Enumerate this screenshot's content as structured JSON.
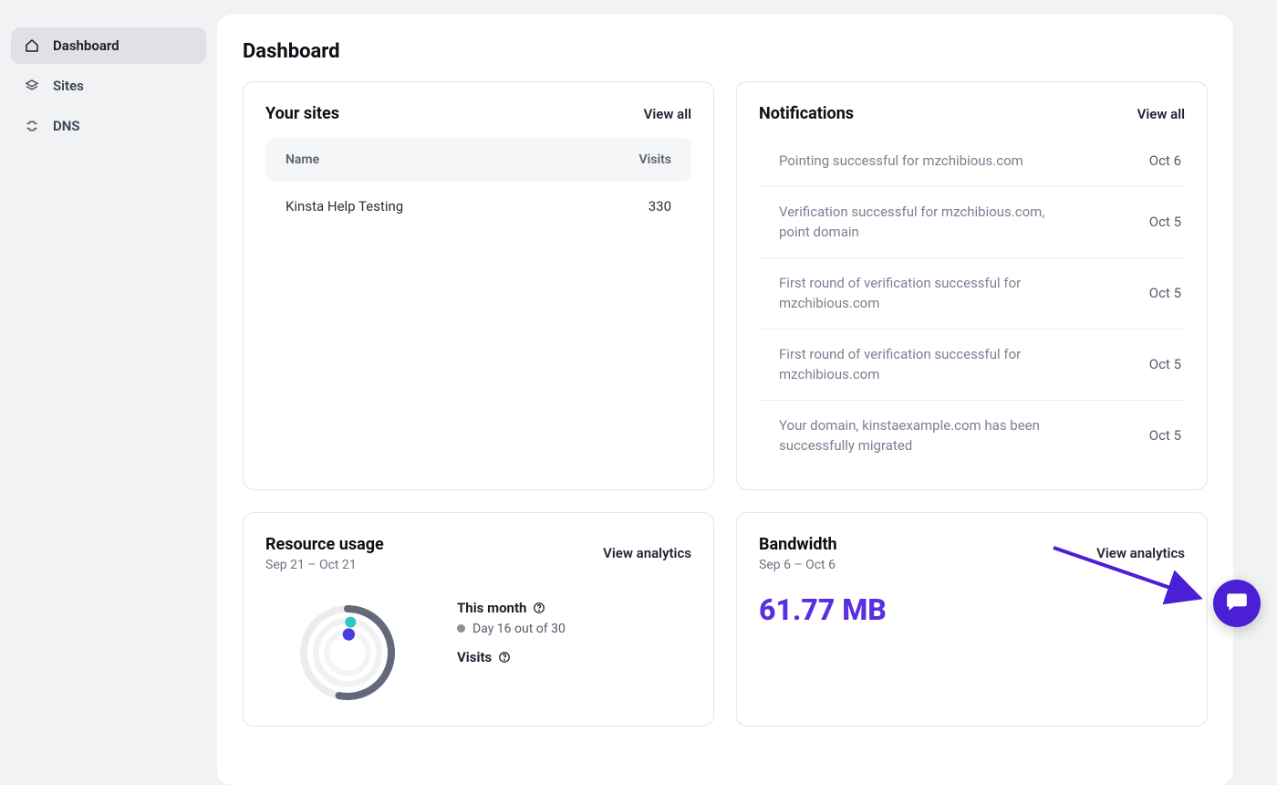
{
  "sidebar": {
    "items": [
      {
        "label": "Dashboard"
      },
      {
        "label": "Sites"
      },
      {
        "label": "DNS"
      }
    ]
  },
  "page": {
    "title": "Dashboard"
  },
  "sites_card": {
    "title": "Your sites",
    "view_all": "View all",
    "col_name": "Name",
    "col_visits": "Visits",
    "rows": [
      {
        "name": "Kinsta Help Testing",
        "visits": "330"
      }
    ]
  },
  "notifications_card": {
    "title": "Notifications",
    "view_all": "View all",
    "items": [
      {
        "text": "Pointing successful for mzchibious.com",
        "date": "Oct 6"
      },
      {
        "text": "Verification successful for mzchibious.com, point domain",
        "date": "Oct 5"
      },
      {
        "text": "First round of verification successful for mzchibious.com",
        "date": "Oct 5"
      },
      {
        "text": "First round of verification successful for mzchibious.com",
        "date": "Oct 5"
      },
      {
        "text": "Your domain, kinstaexample.com has been successfully migrated",
        "date": "Oct 5"
      }
    ]
  },
  "resource_card": {
    "title": "Resource usage",
    "link": "View analytics",
    "range": "Sep 21 – Oct 21",
    "this_month_label": "This month",
    "day_progress": "Day 16 out of 30",
    "visits_label": "Visits"
  },
  "bandwidth_card": {
    "title": "Bandwidth",
    "link": "View analytics",
    "range": "Sep 6 – Oct 6",
    "value": "61.77 MB"
  },
  "colors": {
    "accent_purple": "#5a2fe0",
    "teal": "#2cc9c0",
    "indigo": "#4b39e6"
  },
  "chart_data": {
    "type": "pie",
    "title": "Resource usage - current billing month progress",
    "series": [
      {
        "name": "days_elapsed_pct",
        "value": 53,
        "note": "Day 16 of 30 ≈ 53% of month elapsed"
      }
    ],
    "inner_dots": [
      {
        "name": "visits",
        "color": "#2cc9c0"
      },
      {
        "name": "other",
        "color": "#4b39e6"
      }
    ]
  }
}
